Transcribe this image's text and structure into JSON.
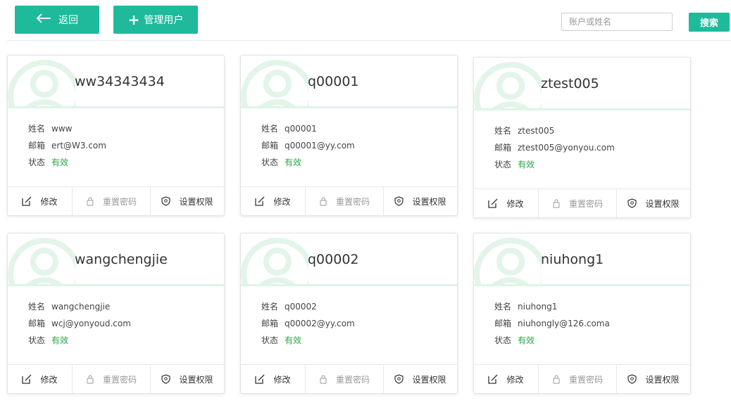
{
  "toolbar": {
    "back_label": "返回",
    "manage_label": "管理用户",
    "search_placeholder": "账户或姓名",
    "search_label": "搜索"
  },
  "labels": {
    "name": "姓名",
    "email": "邮箱",
    "status": "状态"
  },
  "actions": {
    "edit": "修改",
    "reset": "重置密码",
    "perm": "设置权限"
  },
  "users": [
    {
      "account": "ww34343434",
      "name": "www",
      "email": "ert@W3.com",
      "status": "有效"
    },
    {
      "account": "q00001",
      "name": "q00001",
      "email": "q00001@yy.com",
      "status": "有效"
    },
    {
      "account": "ztest005",
      "name": "ztest005",
      "email": "ztest005@yonyou.com",
      "status": "有效"
    },
    {
      "account": "wangchengjie",
      "name": "wangchengjie",
      "email": "wcj@yonyoud.com",
      "status": "有效"
    },
    {
      "account": "q00002",
      "name": "q00002",
      "email": "q00002@yy.com",
      "status": "有效"
    },
    {
      "account": "niuhong1",
      "name": "niuhong1",
      "email": "niuhongly@126.coma",
      "status": "有效"
    }
  ],
  "colors": {
    "accent": "#1fba9c",
    "status_ok": "#28a745",
    "avatar": "#dff4e6"
  }
}
